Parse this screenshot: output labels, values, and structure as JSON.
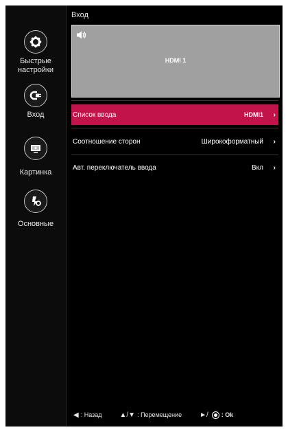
{
  "sidebar": {
    "items": [
      {
        "label": "Быстрые настройки",
        "icon": "gear-icon"
      },
      {
        "label": "Вход",
        "icon": "input-icon"
      },
      {
        "label": "Картинка",
        "icon": "picture-icon"
      },
      {
        "label": "Основные",
        "icon": "tools-icon"
      }
    ]
  },
  "main": {
    "title": "Вход",
    "preview": {
      "source": "HDMI 1",
      "icon": "speaker-icon"
    },
    "rows": [
      {
        "label": "Список ввода",
        "value": "HDMI1"
      },
      {
        "label": "Соотношение сторон",
        "value": "Широкоформатный"
      },
      {
        "label": "Авт. переключатель ввода",
        "value": "Вкл"
      }
    ],
    "chevron": "›"
  },
  "footer": {
    "back": ": Назад",
    "move_glyph": "▲/▼",
    "move": ": Перемещение",
    "ok_glyph": "►/",
    "ok": ": Ok"
  },
  "colors": {
    "accent": "#c2134b",
    "preview_bg": "#a0a0a0",
    "background": "#000000"
  }
}
